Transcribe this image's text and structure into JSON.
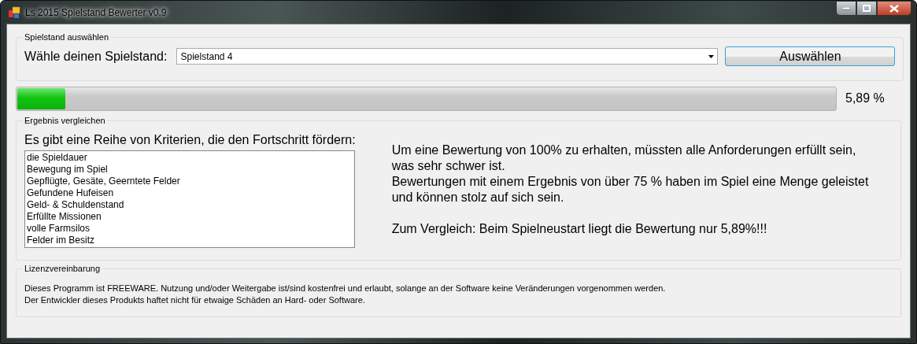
{
  "window": {
    "title": "Ls 2015 Spielstand Bewerter v0.9"
  },
  "select_group": {
    "title": "Spielstand auswählen",
    "label": "Wähle deinen Spielstand:",
    "dropdown_value": "Spielstand 4",
    "button": "Auswählen"
  },
  "progress": {
    "level": 0.0589,
    "reading": "5,89 %"
  },
  "compare_group": {
    "title": "Ergebnis vergleichen",
    "heading": "Es gibt eine Reihe von Kriterien, die den Fortschritt fördern:",
    "criteria": [
      "die Spieldauer",
      "Bewegung im Spiel",
      "Gepflügte, Gesäte, Geerntete Felder",
      "Gefundene Hufeisen",
      "Geld- & Schuldenstand",
      "Erfüllte Missionen",
      "volle Farmsilos",
      "Felder im Besitz"
    ],
    "explanation": "Um eine Bewertung von 100% zu erhalten, müssten alle Anforderungen erfüllt sein,\nwas sehr schwer ist.\nBewertungen mit einem Ergebnis von über 75 % haben im Spiel eine Menge geleistet\nund können stolz auf sich sein.\n\nZum Vergleich: Beim Spielneustart liegt die Bewertung nur 5,89%!!!"
  },
  "license_group": {
    "title": "Lizenzvereinbarung",
    "text": "Dieses Programm ist FREEWARE. Nutzung und/oder Weitergabe ist/sind kostenfrei und erlaubt, solange an der Software keine Veränderungen vorgenommen werden.\nDer Entwickler dieses Produkts haftet nicht für etwaige Schäden an Hard- oder Software."
  }
}
